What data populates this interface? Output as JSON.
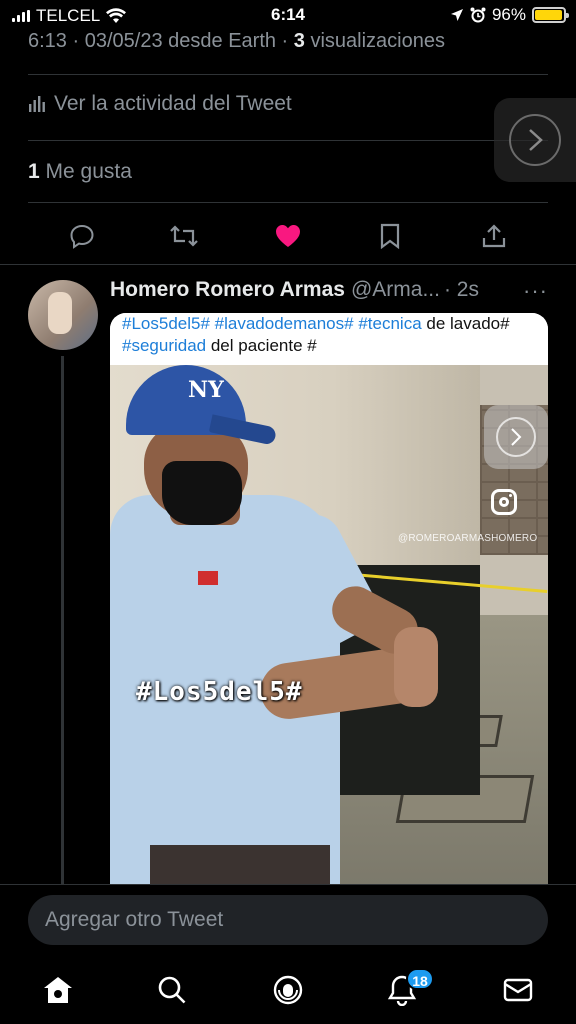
{
  "status_bar": {
    "carrier": "TELCEL",
    "time": "6:14",
    "battery": "96%",
    "battery_level": 0.96,
    "battery_color": "#ffd60a"
  },
  "tweet": {
    "time": "6:13",
    "date": "03/05/23",
    "source": "desde Earth",
    "views_count": "3",
    "views_label": "visualizaciones",
    "activity_label": "Ver la actividad del Tweet",
    "likes_count": "1",
    "likes_label": "Me gusta",
    "liked": true,
    "like_color": "#f91880"
  },
  "reply": {
    "name": "Homero Romero Armas",
    "handle": "@Arma...",
    "age": "· 2s",
    "more": "···",
    "caption": [
      {
        "text": "#Los5del5#",
        "hashtag": true
      },
      {
        "text": " ",
        "hashtag": false
      },
      {
        "text": "#lavadodemanos#",
        "hashtag": true
      },
      {
        "text": " ",
        "hashtag": false
      },
      {
        "text": "#tecnica",
        "hashtag": true
      },
      {
        "text": " de lavado# ",
        "hashtag": false
      },
      {
        "text": "#seguridad",
        "hashtag": true
      },
      {
        "text": " del paciente #",
        "hashtag": false
      }
    ],
    "video_overlay_text": "#Los5del5#",
    "instagram_handle": "@ROMEROARMASHOMERO"
  },
  "compose": {
    "placeholder": "Agregar otro Tweet"
  },
  "tab_bar": {
    "items": [
      "home-icon",
      "search-icon",
      "spaces-icon",
      "notifications-icon",
      "messages-icon"
    ],
    "notifications_badge": "18"
  },
  "colors": {
    "accent": "#1d9bf0",
    "hashtag": "#1d7ed8",
    "secondary_text": "#8b9299"
  }
}
